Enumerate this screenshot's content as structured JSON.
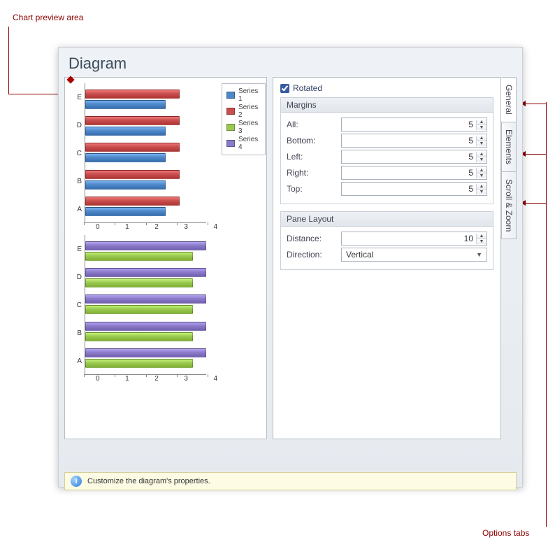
{
  "annotations": {
    "preview": "Chart preview area",
    "tabs": "Options tabs"
  },
  "window": {
    "title": "Diagram"
  },
  "legend": [
    "Series 1",
    "Series 2",
    "Series 3",
    "Series 4"
  ],
  "colors": {
    "series1": "#4f88c9",
    "series2": "#c94f4f",
    "series3": "#9ac94f",
    "series4": "#8a7ac9"
  },
  "options": {
    "rotated_label": "Rotated",
    "rotated_checked": true,
    "margins": {
      "group": "Margins",
      "all_label": "All:",
      "all": "5",
      "bottom_label": "Bottom:",
      "bottom": "5",
      "left_label": "Left:",
      "left": "5",
      "right_label": "Right:",
      "right": "5",
      "top_label": "Top:",
      "top": "5"
    },
    "pane": {
      "group": "Pane Layout",
      "distance_label": "Distance:",
      "distance": "10",
      "direction_label": "Direction:",
      "direction": "Vertical"
    }
  },
  "tabs": {
    "general": "General",
    "elements": "Elements",
    "scroll": "Scroll & Zoom"
  },
  "info": "Customize the diagram's properties.",
  "axis_y": [
    "E",
    "D",
    "C",
    "B",
    "A"
  ],
  "axis_x": [
    "0",
    "1",
    "2",
    "3",
    "4"
  ],
  "chart_data": [
    {
      "type": "bar",
      "orientation": "horizontal",
      "categories": [
        "A",
        "B",
        "C",
        "D",
        "E"
      ],
      "series": [
        {
          "name": "Series 1",
          "color": "#4f88c9",
          "values": [
            3.0,
            3.0,
            3.0,
            3.0,
            3.0
          ]
        },
        {
          "name": "Series 2",
          "color": "#c94f4f",
          "values": [
            3.5,
            3.5,
            3.5,
            3.5,
            3.5
          ]
        }
      ],
      "xlabel": "",
      "ylabel": "",
      "xlim": [
        0,
        4.5
      ],
      "xticks": [
        0,
        1,
        2,
        3,
        4
      ]
    },
    {
      "type": "bar",
      "orientation": "horizontal",
      "categories": [
        "A",
        "B",
        "C",
        "D",
        "E"
      ],
      "series": [
        {
          "name": "Series 3",
          "color": "#9ac94f",
          "values": [
            4.0,
            4.0,
            4.0,
            4.0,
            4.0
          ]
        },
        {
          "name": "Series 4",
          "color": "#8a7ac9",
          "values": [
            4.5,
            4.5,
            4.5,
            4.5,
            4.5
          ]
        }
      ],
      "xlabel": "",
      "ylabel": "",
      "xlim": [
        0,
        4.5
      ],
      "xticks": [
        0,
        1,
        2,
        3,
        4
      ]
    }
  ]
}
